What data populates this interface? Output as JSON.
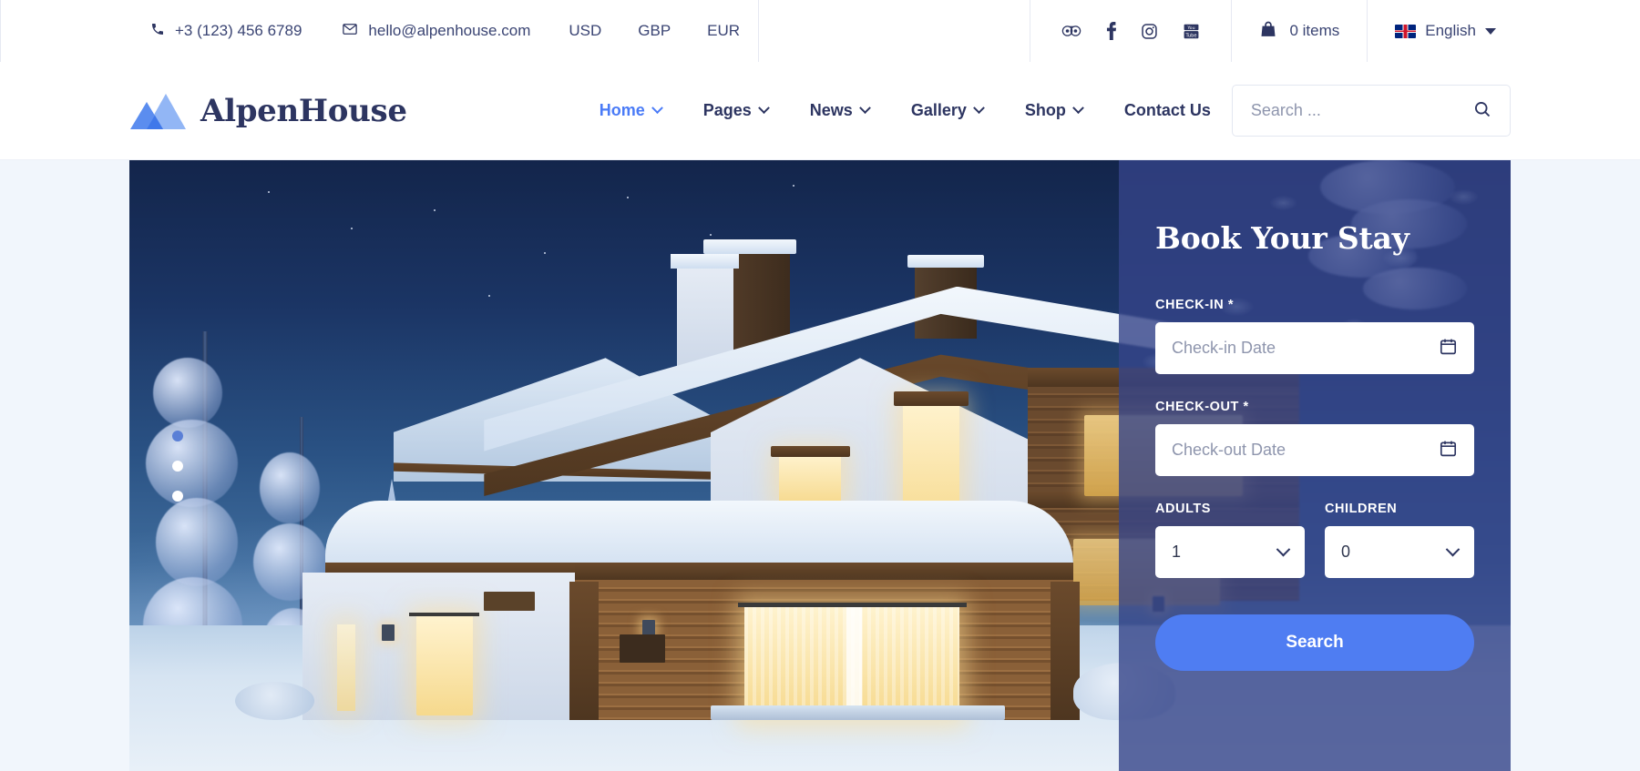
{
  "topbar": {
    "phone": "+3 (123) 456 6789",
    "email": "hello@alpenhouse.com",
    "currencies": [
      "USD",
      "GBP",
      "EUR"
    ],
    "social": [
      "tripadvisor-icon",
      "facebook-icon",
      "instagram-icon",
      "youtube-icon"
    ],
    "cart_label": "0 items",
    "language": "English"
  },
  "header": {
    "brand": "AlpenHouse",
    "nav": [
      {
        "label": "Home",
        "caret": true,
        "active": true
      },
      {
        "label": "Pages",
        "caret": true,
        "active": false
      },
      {
        "label": "News",
        "caret": true,
        "active": false
      },
      {
        "label": "Gallery",
        "caret": true,
        "active": false
      },
      {
        "label": "Shop",
        "caret": true,
        "active": false
      },
      {
        "label": "Contact Us",
        "caret": false,
        "active": false
      }
    ],
    "search_placeholder": "Search ...",
    "search_value": ""
  },
  "booking": {
    "title": "Book Your Stay",
    "checkin_label": "CHECK-IN",
    "checkin_required": "*",
    "checkin_placeholder": "Check-in Date",
    "checkout_label": "CHECK-OUT",
    "checkout_required": "*",
    "checkout_placeholder": "Check-out Date",
    "adults_label": "ADULTS",
    "adults_value": "1",
    "children_label": "CHILDREN",
    "children_value": "0",
    "submit_label": "Search"
  },
  "slider": {
    "dots": 3,
    "active_index": 1
  },
  "colors": {
    "accent_blue": "#4f7df2",
    "navy": "#2d3561",
    "panel_overlay": "#344488",
    "page_bg": "#f1f6fc",
    "muted_text": "#8e95ad"
  }
}
